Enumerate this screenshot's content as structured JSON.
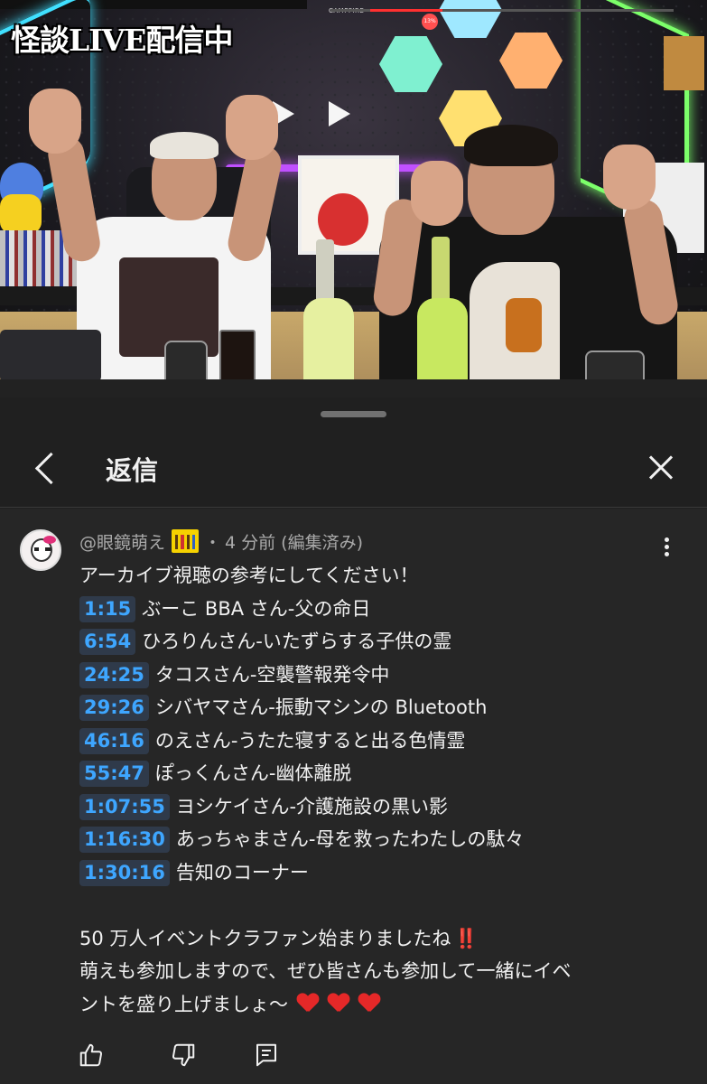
{
  "video": {
    "overlay_title": "怪談LIVE配信中",
    "sponsor_text": "CAMPFIRE",
    "progress_badge": "13%",
    "accent": "#ff3030"
  },
  "sheet": {
    "header_title": "返信",
    "back_icon": "chevron-left-icon",
    "close_icon": "close-icon"
  },
  "comment": {
    "author": "@眼鏡萌え",
    "separator": "・",
    "time": "4 分前",
    "edited": "(編集済み)",
    "intro": "アーカイブ視聴の参考にしてください！",
    "chapters": [
      {
        "time": "1:15",
        "title": "ぶーこ BBA さん-父の命日"
      },
      {
        "time": "6:54",
        "title": "ひろりんさん-いたずらする子供の霊"
      },
      {
        "time": "24:25",
        "title": "タコスさん-空襲警報発令中"
      },
      {
        "time": "29:26",
        "title": "シバヤマさん-振動マシンの Bluetooth"
      },
      {
        "time": "46:16",
        "title": "のえさん-うたた寝すると出る色情霊"
      },
      {
        "time": "55:47",
        "title": "ぽっくんさん-幽体離脱"
      },
      {
        "time": "1:07:55",
        "title": "ヨシケイさん-介護施設の黒い影"
      },
      {
        "time": "1:16:30",
        "title": "あっちゃまさん-母を救ったわたしの駄々"
      },
      {
        "time": "1:30:16",
        "title": "告知のコーナー"
      }
    ],
    "announcement_line1": "50 万人イベントクラファン始まりましたね",
    "announcement_bang": "‼️",
    "announcement_line2": "萌えも参加しますので、ぜひ皆さんも参加して一緒にイベ",
    "announcement_line3": "ントを盛り上げましょ〜",
    "timestamp_color": "#3ea6ff",
    "icons": [
      "like-icon",
      "dislike-icon",
      "reply-icon",
      "more-vert-icon"
    ]
  }
}
